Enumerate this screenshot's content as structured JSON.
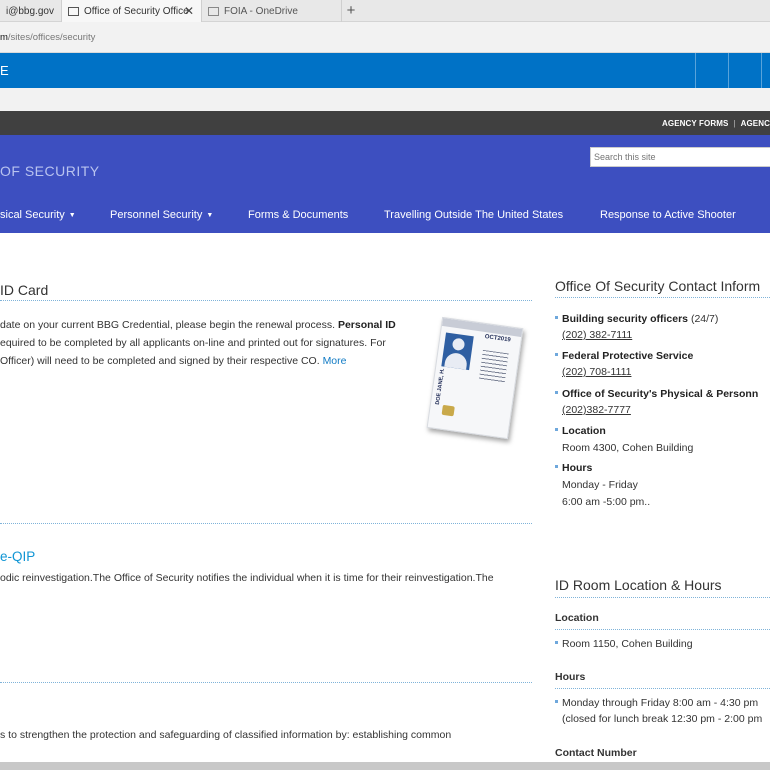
{
  "browser": {
    "tabs": [
      {
        "label": "i@bbg.gov"
      },
      {
        "label": "Office of Security Office"
      },
      {
        "label": "FOIA - OneDrive"
      }
    ],
    "new_tab_symbol": "+",
    "close_symbol": "✕",
    "url_host": "m",
    "url_path": "/sites/offices/security"
  },
  "sharepoint_bar": {
    "text": "E"
  },
  "agency_links": {
    "forms": "AGENCY FORMS",
    "separator": "|",
    "next": "AGENC"
  },
  "header": {
    "site_title": "OF SECURITY",
    "search_placeholder": "Search this site",
    "nav": [
      {
        "label": "sical Security",
        "caret": "▼"
      },
      {
        "label": "Personnel Security",
        "caret": "▼"
      },
      {
        "label": "Forms & Documents"
      },
      {
        "label": "Travelling Outside The United States"
      },
      {
        "label": "Response to Active Shooter"
      }
    ]
  },
  "main": {
    "id_card": {
      "title": "ID Card",
      "line1_prefix": "date on your current BBG Credential, please begin the renewal process. ",
      "line1_bold": "Personal ID",
      "line2": "equired to be completed by all applicants on-line and printed out for signatures. For",
      "line3": "Officer) will need to be completed and signed by their respective CO. ",
      "more": "More",
      "card_date": "OCT2019",
      "card_name": "DOE JANE, H."
    },
    "eqip": {
      "title": "e-QIP",
      "text": "odic reinvestigation.The Office of Security notifies the individual when it is time for their reinvestigation.The"
    },
    "third": {
      "text": "s to strengthen the protection and safeguarding of classified information by: establishing common"
    }
  },
  "sidebar": {
    "contact_title": "Office Of Security Contact Inform",
    "contacts": [
      {
        "label": "Building security officers",
        "suffix": " (24/7)",
        "phone": "(202) 382-7111"
      },
      {
        "label": "Federal Protective Service",
        "suffix": "",
        "phone": "(202) 708-1111"
      },
      {
        "label": "Office of Security's Physical & Personn",
        "suffix": "",
        "phone": "(202)382-7777"
      }
    ],
    "location_label": "Location",
    "location_value": "Room 4300, Cohen Building",
    "hours_label": "Hours",
    "hours_days": "Monday - Friday",
    "hours_time": "6:00 am -5:00 pm..",
    "idroom_title": "ID Room Location & Hours",
    "idroom_location_label": "Location",
    "idroom_location_value": "Room 1150, Cohen Building",
    "idroom_hours_label": "Hours",
    "idroom_hours_line1": "Monday through Friday 8:00 am - 4:30 pm",
    "idroom_hours_line2": "(closed for lunch break 12:30 pm - 2:00 pm",
    "contact_number_label": "Contact Number"
  }
}
